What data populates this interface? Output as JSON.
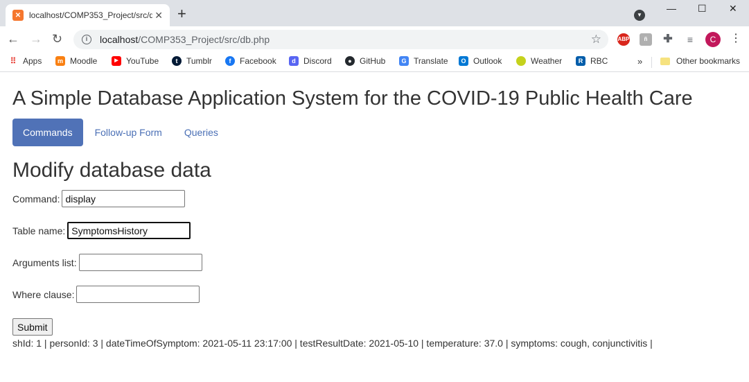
{
  "browser": {
    "tab_title": "localhost/COMP353_Project/src/db.php",
    "url_host": "localhost",
    "url_path": "/COMP353_Project/src/db.php",
    "bookmarks": [
      {
        "label": "Apps",
        "icon": "apps-grid-icon",
        "color": "#e8453c"
      },
      {
        "label": "Moodle",
        "icon": "moodle-icon",
        "color": "#f98012"
      },
      {
        "label": "YouTube",
        "icon": "youtube-icon",
        "color": "#ff0000"
      },
      {
        "label": "Tumblr",
        "icon": "tumblr-icon",
        "color": "#001935"
      },
      {
        "label": "Facebook",
        "icon": "facebook-icon",
        "color": "#1877f2"
      },
      {
        "label": "Discord",
        "icon": "discord-icon",
        "color": "#5865f2"
      },
      {
        "label": "GitHub",
        "icon": "github-icon",
        "color": "#24292e"
      },
      {
        "label": "Translate",
        "icon": "translate-icon",
        "color": "#4285f4"
      },
      {
        "label": "Outlook",
        "icon": "outlook-icon",
        "color": "#0078d4"
      },
      {
        "label": "Weather",
        "icon": "weather-icon",
        "color": "#c5d21c"
      },
      {
        "label": "RBC",
        "icon": "rbc-icon",
        "color": "#005daa"
      }
    ],
    "other_bookmarks": "Other bookmarks",
    "profile_initial": "C"
  },
  "page": {
    "title": "A Simple Database Application System for the COVID-19 Public Health Care",
    "nav": [
      {
        "label": "Commands",
        "active": true
      },
      {
        "label": "Follow-up Form",
        "active": false
      },
      {
        "label": "Queries",
        "active": false
      }
    ],
    "section_title": "Modify database data",
    "form": {
      "command_label": "Command:",
      "command_value": "display",
      "table_label": "Table name:",
      "table_value": "SymptomsHistory",
      "args_label": "Arguments list:",
      "args_value": "",
      "where_label": "Where clause:",
      "where_value": "",
      "submit_label": "Submit"
    },
    "result": "shId: 1 | personId: 3 | dateTimeOfSymptom: 2021-05-11 23:17:00 | testResultDate: 2021-05-10 | temperature: 37.0 | symptoms: cough, conjunctivitis |"
  },
  "colors": {
    "accent": "#5072b7",
    "link": "#4a6fb5"
  }
}
